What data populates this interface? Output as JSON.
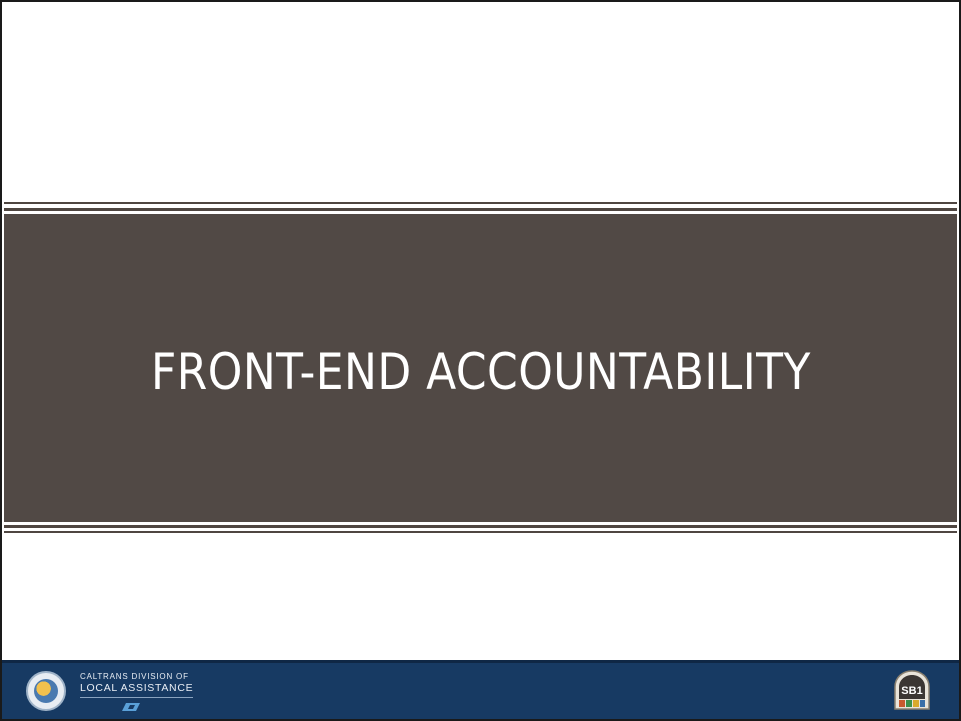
{
  "slide": {
    "title": "FRONT-END ACCOUNTABILITY"
  },
  "footer": {
    "division_line1": "CALTRANS DIVISION OF",
    "division_line2": "LOCAL ASSISTANCE",
    "badge_text": "SB1",
    "left_icons": [
      "state-seal-icon",
      "caltrans-logo-icon"
    ],
    "right_icons": [
      "sb1-shield-icon"
    ]
  },
  "colors": {
    "band": "#514945",
    "footer": "#173a63",
    "title_text": "#ffffff"
  }
}
